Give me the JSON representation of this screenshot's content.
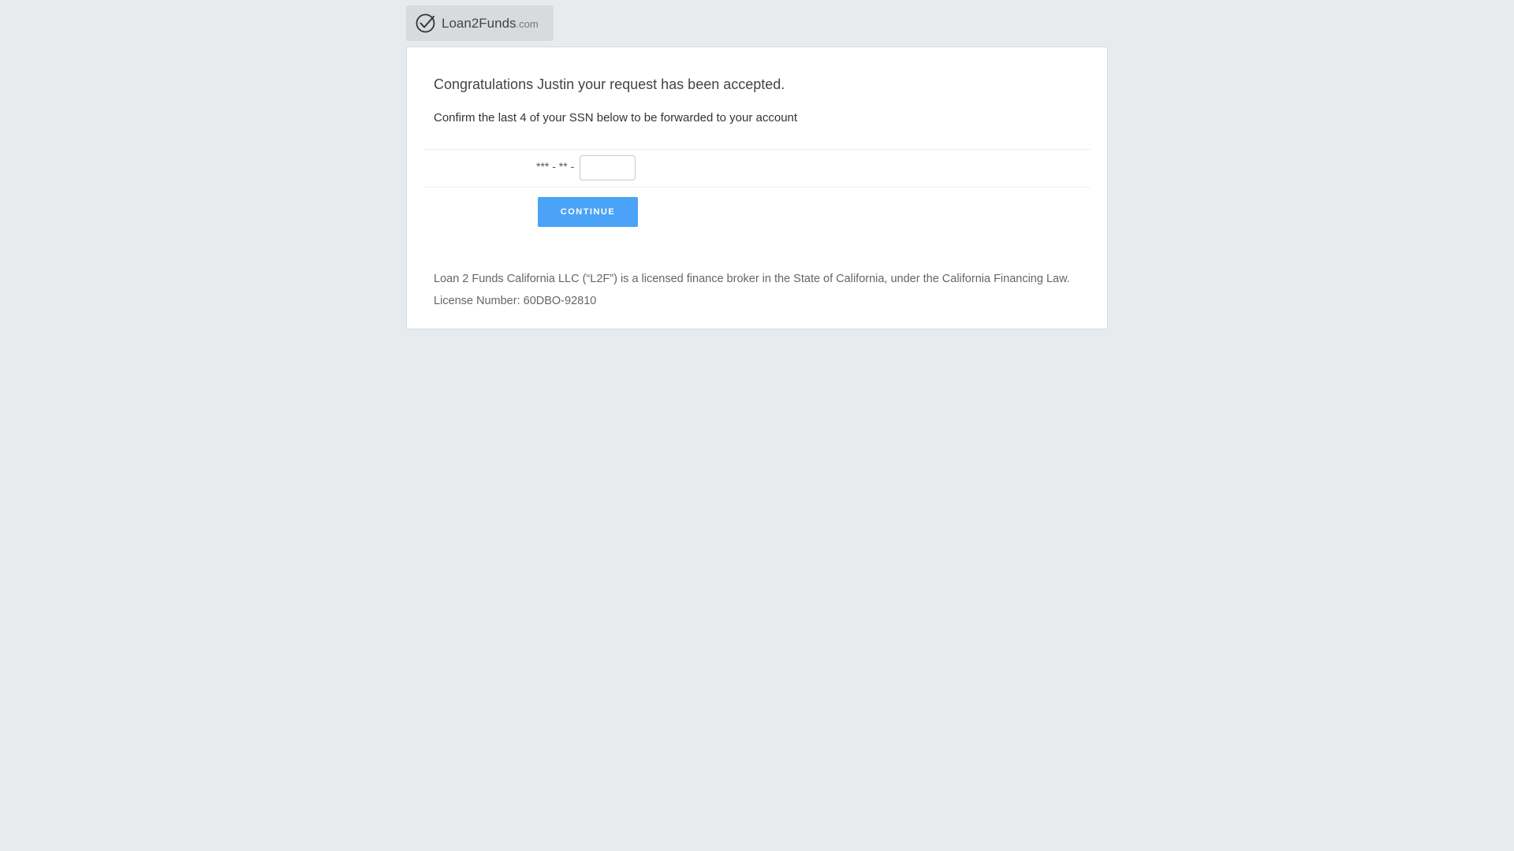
{
  "brand": {
    "name": "Loan2Funds",
    "tld": ".com",
    "icon": "check-circle-icon"
  },
  "card": {
    "heading": "Congratulations Justin your request has been accepted.",
    "instruction": "Confirm the last 4 of your SSN below to be forwarded to your account",
    "ssn_mask": "*** - ** -",
    "ssn_value": "",
    "continue_label": "CONTINUE",
    "disclaimer_line1": "Loan 2 Funds California LLC (“L2F”) is a licensed finance broker in the State of California, under the California Financing Law.",
    "disclaimer_line2": "License Number: 60DBO-92810"
  },
  "colors": {
    "background": "#e8ebed",
    "accent": "#4aa3f7"
  }
}
